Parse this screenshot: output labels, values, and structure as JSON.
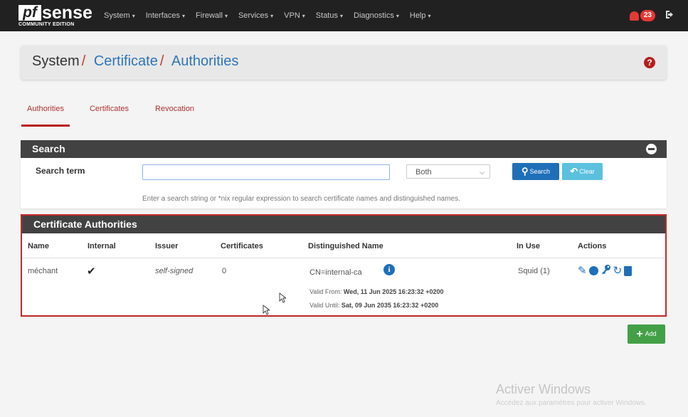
{
  "brand": {
    "logo_mark": "pf",
    "logo_word": "sense",
    "edition": "COMMUNITY EDITION"
  },
  "nav": {
    "items": [
      {
        "label": "System"
      },
      {
        "label": "Interfaces"
      },
      {
        "label": "Firewall"
      },
      {
        "label": "Services"
      },
      {
        "label": "VPN"
      },
      {
        "label": "Status"
      },
      {
        "label": "Diagnostics"
      },
      {
        "label": "Help"
      }
    ],
    "caret": "▾",
    "notification_count": "23",
    "icons": {
      "bell": "bell-icon",
      "logout": "sign-out-icon"
    }
  },
  "breadcrumb": {
    "root": "System",
    "sep": "/",
    "level1": "Certificate",
    "level2": "Authorities",
    "help_glyph": "?"
  },
  "tabs": [
    {
      "label": "Authorities",
      "active": true
    },
    {
      "label": "Certificates",
      "active": false
    },
    {
      "label": "Revocation",
      "active": false
    }
  ],
  "search": {
    "panel_title": "Search",
    "term_label": "Search term",
    "input_value": "",
    "scope_selected": "Both",
    "search_button": "Search",
    "clear_button": "Clear",
    "help_text": "Enter a search string or *nix regular expression to search certificate names and distinguished names."
  },
  "ca_table": {
    "panel_title": "Certificate Authorities",
    "columns": [
      "Name",
      "Internal",
      "Issuer",
      "Certificates",
      "Distinguished Name",
      "In Use",
      "Actions"
    ],
    "rows": [
      {
        "name": "méchant",
        "internal": "✔",
        "issuer": "self-signed",
        "certificates": "0",
        "distinguished_name": "CN=internal-ca",
        "valid_from_label": "Valid From:",
        "valid_from": "Wed, 11 Jun 2025 16:23:32 +0200",
        "valid_until_label": "Valid Until:",
        "valid_until": "Sat, 09 Jun 2035 16:23:32 +0200",
        "in_use": "Squid (1)",
        "actions": [
          "edit-icon",
          "export-icon",
          "key-icon",
          "renew-icon",
          "trash-icon"
        ]
      }
    ]
  },
  "add_button": "Add",
  "watermark": {
    "title": "Activer Windows",
    "subtitle": "Accédez aux paramètres pour activer Windows."
  },
  "colors": {
    "navbar": "#212121",
    "panel_header": "#424242",
    "link_blue": "#2e75b6",
    "accent_red": "#b71c1c",
    "btn_primary": "#1f6fb8",
    "btn_info": "#5bc0de",
    "btn_success": "#43a047"
  }
}
